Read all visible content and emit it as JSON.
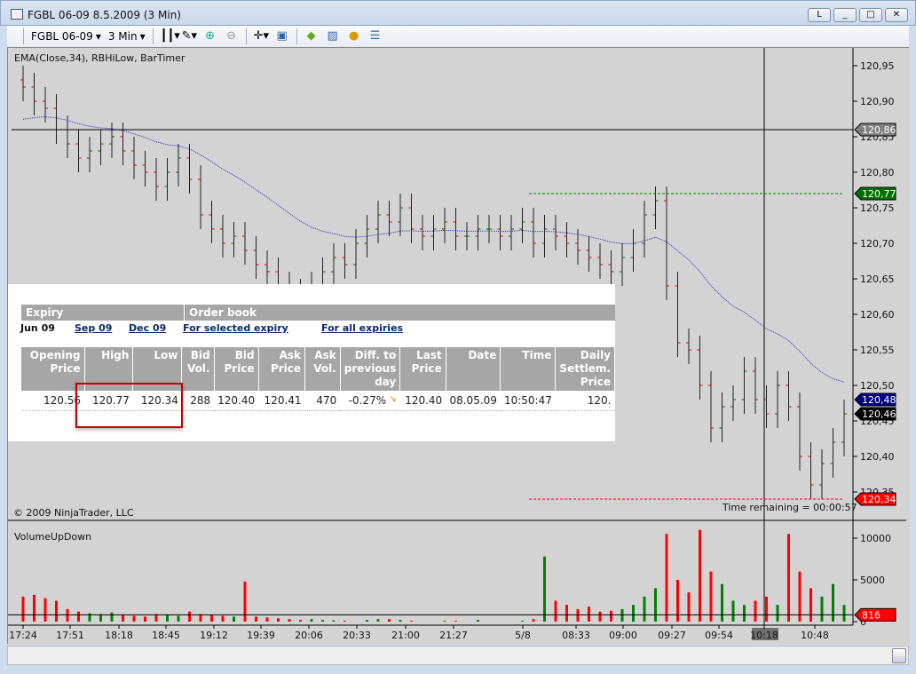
{
  "window": {
    "title": "FGBL 06-09  8.5.2009 (3 Min)",
    "buttons": [
      "L",
      "_",
      "□",
      "✕"
    ]
  },
  "toolbar": {
    "instrument": "FGBL 06-09",
    "interval": "3 Min"
  },
  "chart": {
    "indicators_label": "EMA(Close,34), RBHiLow, BarTimer",
    "copyright": "© 2009 NinjaTrader, LLC",
    "time_remaining": "Time remaining = 00:00:57",
    "volume_label": "VolumeUpDown"
  },
  "chart_data": {
    "type": "ohlc",
    "price_ticks": [
      "120,95",
      "120,90",
      "120,85",
      "120,80",
      "120,75",
      "120,70",
      "120,65",
      "120,60",
      "120,55",
      "120,50",
      "120,45",
      "120,40",
      "120,35"
    ],
    "price_tick_values": [
      120.95,
      120.9,
      120.85,
      120.8,
      120.75,
      120.7,
      120.65,
      120.6,
      120.55,
      120.5,
      120.45,
      120.4,
      120.35
    ],
    "volume_ticks": [
      "10000",
      "5000",
      "0"
    ],
    "volume_tick_values": [
      10000,
      5000,
      0
    ],
    "time_labels": [
      "17:24",
      "17:51",
      "18:18",
      "18:45",
      "19:12",
      "19:39",
      "20:06",
      "20:33",
      "21:00",
      "21:27",
      "5/8",
      "08:33",
      "09:00",
      "09:27",
      "09:54",
      "10:18",
      "10:48"
    ],
    "highlighted_time": "10:18",
    "closes": [
      120.92,
      120.9,
      120.89,
      120.86,
      120.84,
      120.82,
      120.83,
      120.84,
      120.85,
      120.83,
      120.81,
      120.8,
      120.78,
      120.8,
      120.82,
      120.79,
      120.74,
      120.72,
      120.7,
      120.71,
      120.69,
      120.67,
      120.66,
      120.64,
      120.63,
      120.62,
      120.64,
      120.66,
      120.68,
      120.67,
      120.7,
      120.72,
      120.74,
      120.73,
      120.75,
      120.72,
      120.71,
      120.72,
      120.73,
      120.71,
      120.71,
      120.72,
      120.72,
      120.71,
      120.72,
      120.73,
      120.7,
      120.72,
      120.71,
      120.7,
      120.69,
      120.68,
      120.67,
      120.66,
      120.68,
      120.7,
      120.74,
      120.76,
      120.64,
      120.56,
      120.55,
      120.5,
      120.44,
      120.47,
      120.48,
      120.52,
      120.48,
      120.46,
      120.5,
      120.47,
      120.4,
      120.36,
      120.39,
      120.42,
      120.46
    ],
    "volumes": [
      3000,
      3200,
      2800,
      2500,
      1500,
      1200,
      1000,
      900,
      1100,
      800,
      700,
      600,
      900,
      800,
      700,
      1200,
      900,
      800,
      700,
      600,
      4800,
      600,
      500,
      400,
      300,
      200,
      300,
      200,
      150,
      100,
      0,
      200,
      300,
      300,
      200,
      100,
      0,
      0,
      100,
      100,
      0,
      200,
      0,
      0,
      0,
      100,
      300,
      7800,
      2500,
      2000,
      1500,
      1800,
      1200,
      1300,
      1500,
      2000,
      3000,
      4000,
      10500,
      5000,
      3500,
      11000,
      6000,
      4500,
      2500,
      2000,
      2500,
      3000,
      2000,
      10500,
      6000,
      4000,
      3000,
      4500,
      2000
    ],
    "markers": [
      {
        "label": "120,86",
        "value": 120.86,
        "color": "#808080"
      },
      {
        "label": "120,77",
        "value": 120.77,
        "color": "#007000"
      },
      {
        "label": "120,48",
        "value": 120.48,
        "color": "#000080"
      },
      {
        "label": "120,46",
        "value": 120.46,
        "color": "#000000"
      },
      {
        "label": "120,34",
        "value": 120.34,
        "color": "#ff0000"
      }
    ],
    "volume_marker": {
      "label": "816",
      "value": 816,
      "color": "#ff0000"
    },
    "rb_high": 120.77,
    "rb_low": 120.34,
    "crosshair_price": 120.86,
    "ema_period": 34
  },
  "panel": {
    "header": [
      "Expiry",
      "Order book"
    ],
    "links": [
      "Jun 09",
      "Sep 09",
      "Dec 09",
      "For selected expiry",
      "For all expiries"
    ],
    "columns": [
      "Opening Price",
      "High",
      "Low",
      "Bid Vol.",
      "Bid Price",
      "Ask Price",
      "Ask Vol.",
      "Diff. to previous day",
      "Last Price",
      "Date",
      "Time",
      "Daily Settlem. Price"
    ],
    "row": [
      "120.56",
      "120.77",
      "120.34",
      "288",
      "120.40",
      "120.41",
      "470",
      "-0.27%",
      "120.40",
      "08.05.09",
      "10:50:47",
      "120."
    ]
  }
}
